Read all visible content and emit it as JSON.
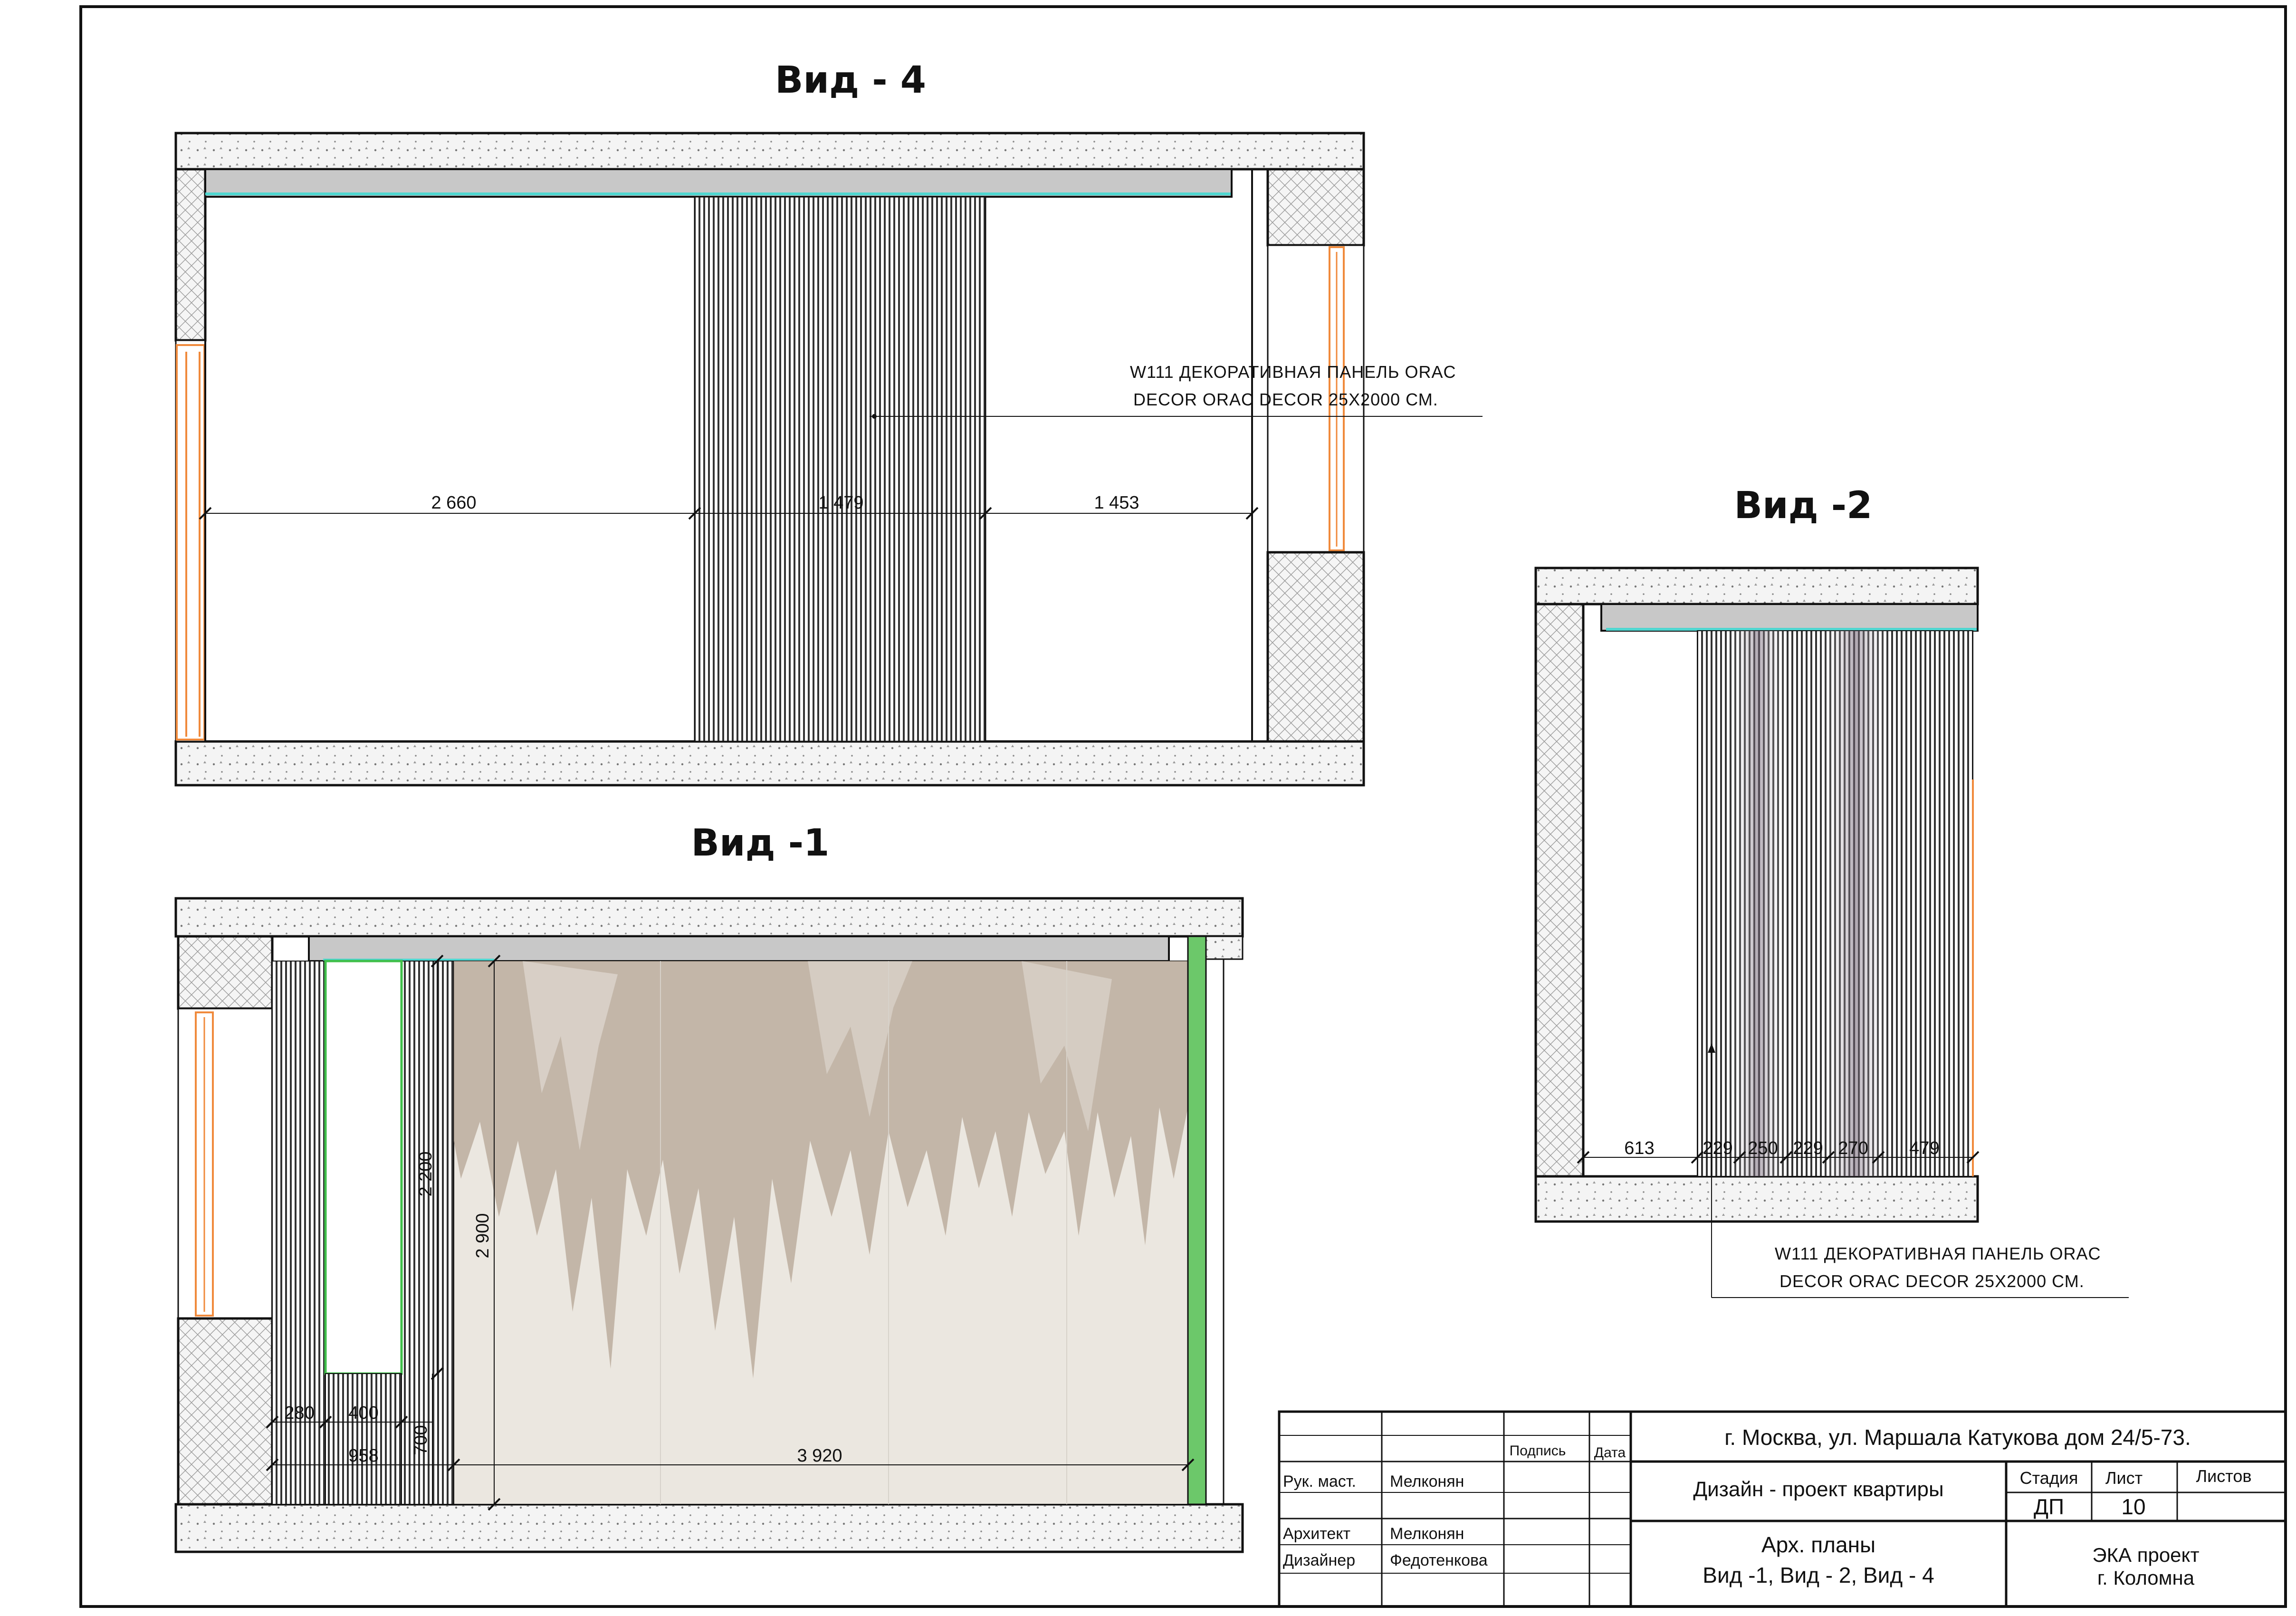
{
  "views": {
    "view4": {
      "title": "Вид - 4",
      "dims": [
        "2 660",
        "1 479",
        "1 453"
      ],
      "note_line1": "W111 ДЕКОРАТИВНАЯ ПАНЕЛЬ ORAC",
      "note_line2": "DECOR ORAC DECOR 25X2000 СМ."
    },
    "view1": {
      "title": "Вид -1",
      "dims": [
        "2 200",
        "2 900",
        "280",
        "400",
        "700",
        "958",
        "3 920"
      ]
    },
    "view2": {
      "title": "Вид -2",
      "dims": [
        "613",
        "229",
        "250",
        "229",
        "270",
        "479"
      ],
      "note_line1": "W111 ДЕКОРАТИВНАЯ ПАНЕЛЬ ORAC",
      "note_line2": "DECOR ORAC DECOR 25X2000 СМ."
    }
  },
  "title_block": {
    "headers": {
      "signature": "Подпись",
      "date": "Дата"
    },
    "address": "г. Москва, ул. Маршала Катукова дом 24/5-73.",
    "project": "Дизайн - проект квартиры",
    "roles": [
      {
        "role": "Рук. маст.",
        "name": "Мелконян"
      },
      {
        "role": "Архитект",
        "name": "Мелконян"
      },
      {
        "role": "Дизайнер",
        "name": "Федотенкова"
      }
    ],
    "stage_label": "Стадия",
    "sheet_label": "Лист",
    "sheets_label": "Листов",
    "stage_value": "ДП",
    "sheet_value": "10",
    "sheet_title_line1": "Арх. планы",
    "sheet_title_line2": "Вид -1, Вид - 2, Вид - 4",
    "company_line1": "ЭКА проект",
    "company_line2": "г. Коломна"
  },
  "colors": {
    "frame": "#111111",
    "slab_fill": "#f4f4f4",
    "ceiling_fill": "#c8c8c8",
    "cyan_line": "#4fd6d0",
    "orange": "#f08a3c",
    "green": "#6cc86a",
    "wallpaper_bg": "#ebe7e0",
    "wallpaper_stain": "#b5a695"
  }
}
